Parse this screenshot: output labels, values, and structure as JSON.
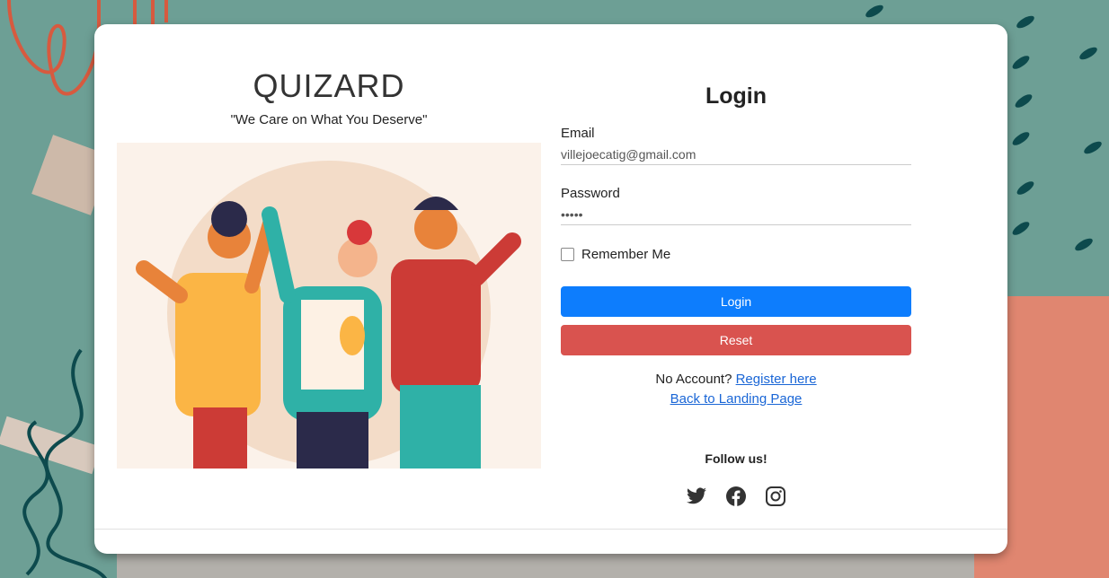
{
  "brand": {
    "title": "QUIZARD",
    "tagline": "\"We Care on What You Deserve\""
  },
  "form": {
    "title": "Login",
    "email": {
      "label": "Email",
      "value": "villejoecatig@gmail.com"
    },
    "password": {
      "label": "Password",
      "value": "•••••"
    },
    "remember_label": "Remember Me",
    "login_label": "Login",
    "reset_label": "Reset",
    "no_account_text": "No Account?",
    "register_link": "Register here",
    "back_link": "Back to Landing Page",
    "follow_title": "Follow us!"
  },
  "colors": {
    "primary": "#0d7dfd",
    "danger": "#d9534f",
    "link": "#1a66d6",
    "background": "#6d9f95"
  },
  "icons": [
    "twitter-icon",
    "facebook-icon",
    "instagram-icon"
  ]
}
